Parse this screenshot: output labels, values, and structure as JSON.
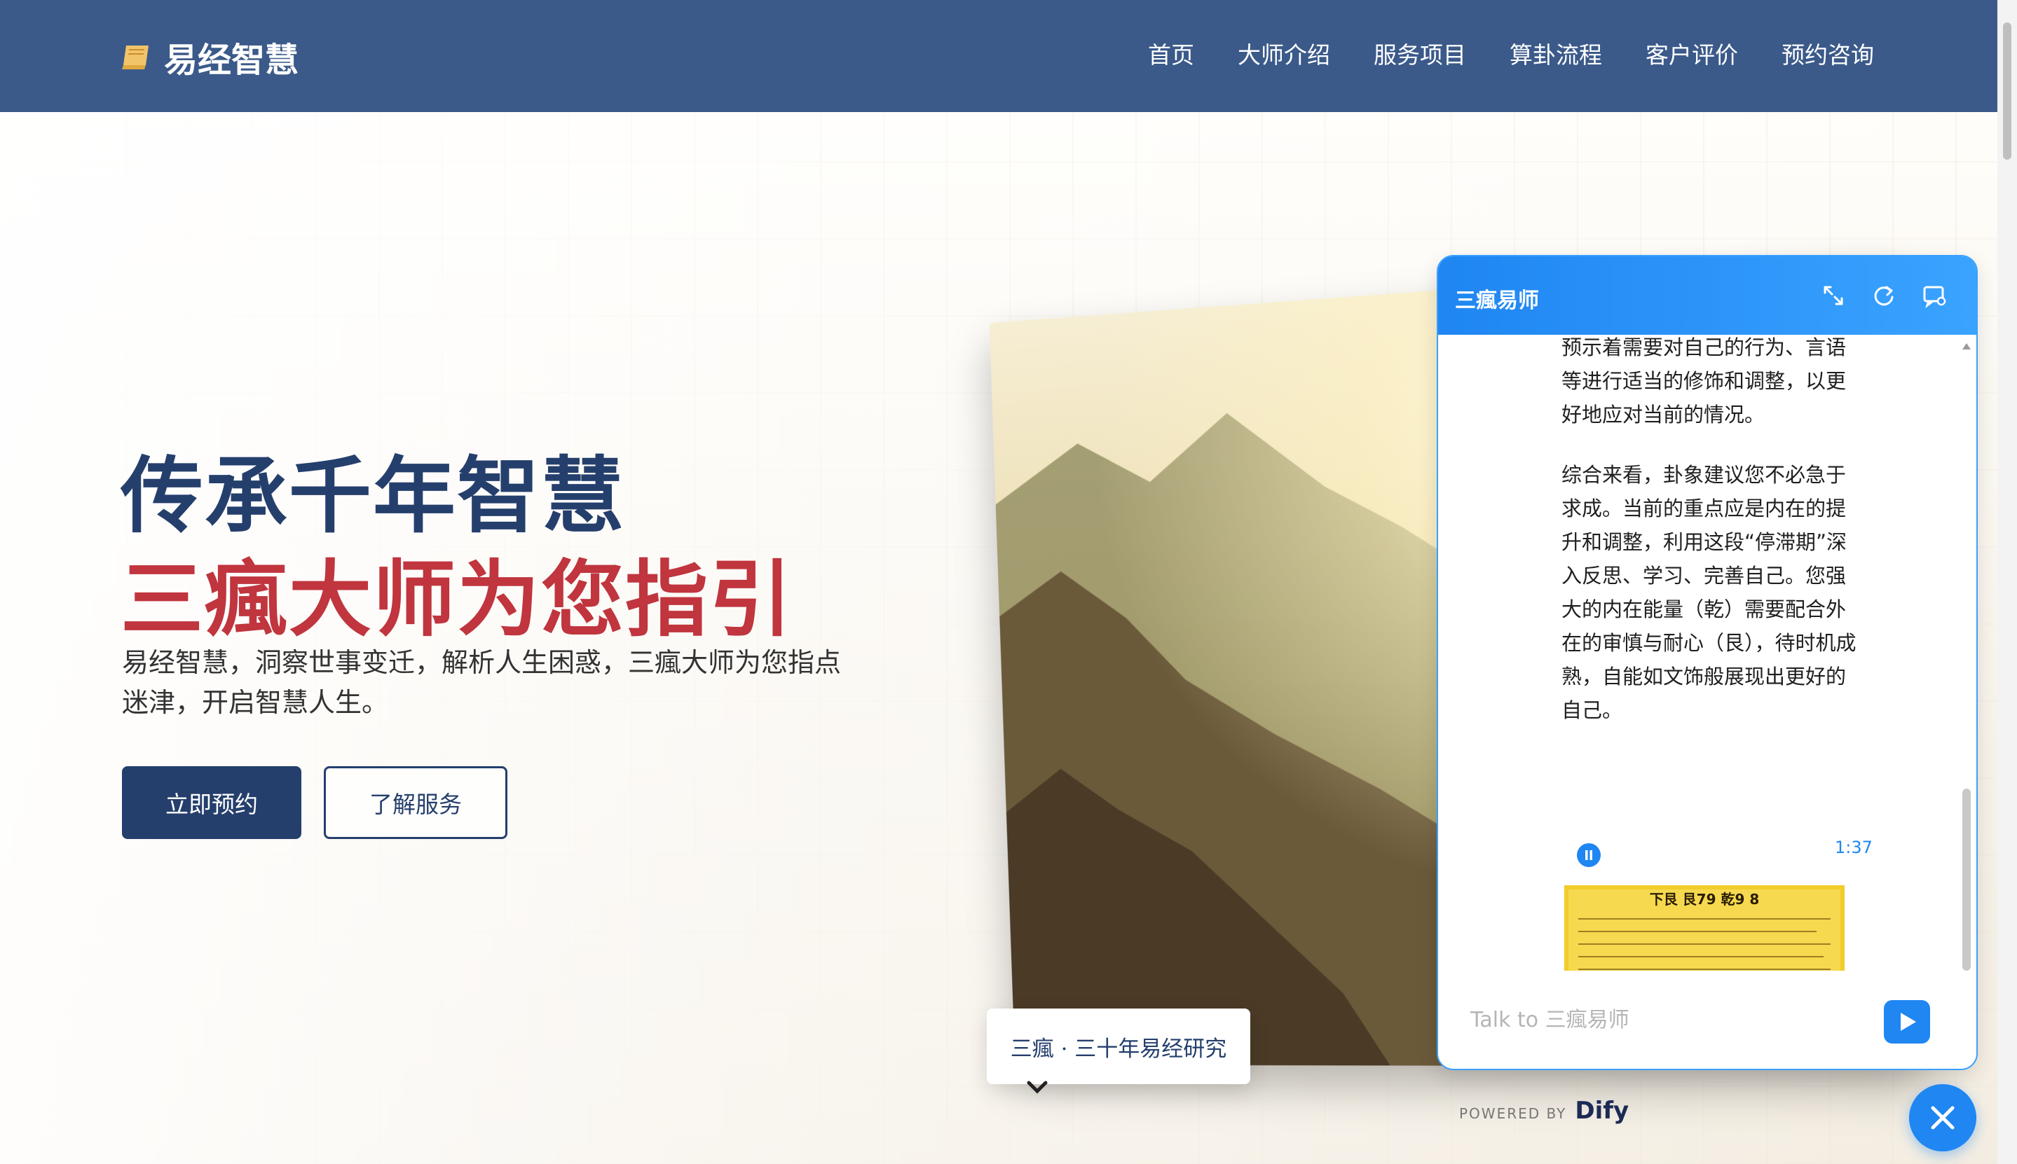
{
  "header": {
    "logo_text": "易经智慧",
    "nav": [
      "首页",
      "大师介绍",
      "服务项目",
      "算卦流程",
      "客户评价",
      "预约咨询"
    ]
  },
  "hero": {
    "title_line1": "传承千年智慧",
    "title_line2": "三瘋大师为您指引",
    "description": "易经智慧，洞察世事变迁，解析人生困惑，三瘋大师为您指点迷津，开启智慧人生。",
    "primary_button": "立即预约",
    "secondary_button": "了解服务",
    "photo_caption": "三瘋 · 三十年易经研究"
  },
  "chat": {
    "title": "三瘋易师",
    "message_part1": "预示着需要对自己的行为、言语等进行适当的修饰和调整，以更好地应对当前的情况。",
    "message_part2": "综合来看，卦象建议您不必急于求成。当前的重点应是内在的提升和调整，利用这段“停滞期”深入反思、学习、完善自己。您强大的内在能量（乾）需要配合外在的审慎与耐心（艮），待时机成熟，自能如文饰般展现出更好的自己。",
    "audio_time": "1:37",
    "image_heading": "下艮 艮79 乾9 8",
    "input_placeholder": "Talk to 三瘋易师",
    "powered_by": "POWERED BY",
    "brand": "Dify"
  },
  "colors": {
    "header_bg": "#3b5a8a",
    "primary": "#253f6d",
    "accent_red": "#c0353e",
    "chat_blue": "#1f86f2"
  }
}
